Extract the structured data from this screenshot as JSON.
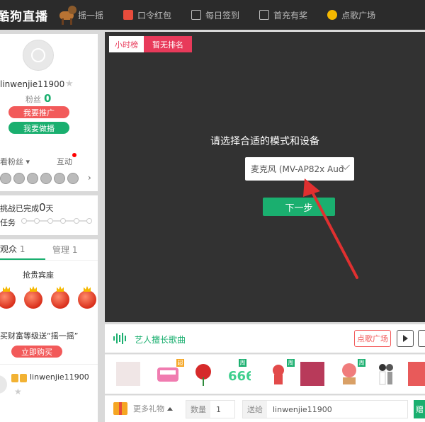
{
  "header": {
    "brand": "酷狗直播",
    "nav": [
      {
        "label": "摇一摇",
        "icon": "shake-icon"
      },
      {
        "label": "口令红包",
        "icon": "red-envelope-icon"
      },
      {
        "label": "每日签到",
        "icon": "checkin-icon"
      },
      {
        "label": "首充有奖",
        "icon": "gift-icon"
      },
      {
        "label": "点歌广场",
        "icon": "microphone-icon"
      }
    ]
  },
  "profile": {
    "username": "linwenjie11900",
    "fans_label": "粉丝",
    "fans_count": "0",
    "promote_label": "我要推广",
    "stream_label": "我要做播",
    "fan_rank_label": "看粉丝",
    "interact_label": "互动"
  },
  "challenge": {
    "done_prefix": "挑战已完成",
    "done_days": "0",
    "done_unit": "天",
    "task_label": "任务"
  },
  "audience": {
    "tabs": [
      {
        "label": "观众",
        "count": "1"
      },
      {
        "label": "管理",
        "count": "1"
      }
    ],
    "grab_label": "抢贵宾座",
    "buy_text": "买财富等级送“摇一摇”",
    "buy_button": "立即购买",
    "viewer_name": "linwenjie11900"
  },
  "stage": {
    "rank_tab_hour": "小时榜",
    "rank_tab_none": "暂无排名",
    "prompt": "请选择合适的模式和设备",
    "device_value": "麦克风 (MV-AP82x Aud",
    "next_button": "下一步"
  },
  "song": {
    "title": "艺人擅长歌曲",
    "square_button": "点歌广场"
  },
  "gifts": {
    "tags": [
      "超",
      "周",
      "周",
      "周"
    ]
  },
  "sendbar": {
    "more_gifts": "更多礼物",
    "qty_label": "数量",
    "qty_value": "1",
    "to_label": "送给",
    "to_value": "linwenjie11900",
    "send_label": "赠"
  },
  "colors": {
    "accent_green": "#1aaf6f",
    "accent_red": "#f25a5a",
    "rank_pink": "#e83a5a",
    "stage_bg": "#323232"
  }
}
